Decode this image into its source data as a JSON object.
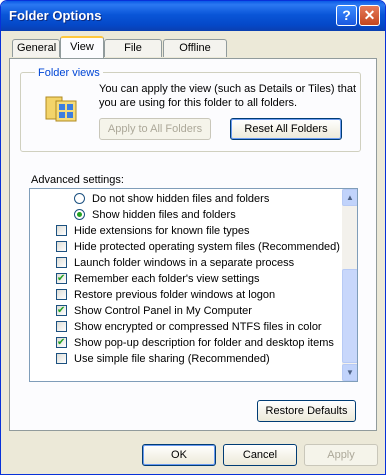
{
  "window": {
    "title": "Folder Options",
    "help_glyph": "?",
    "close_glyph": "✕"
  },
  "tabs": [
    {
      "label": "General"
    },
    {
      "label": "View"
    },
    {
      "label": "File Types"
    },
    {
      "label": "Offline Files"
    }
  ],
  "folder_views": {
    "title": "Folder views",
    "description": "You can apply the view (such as Details or Tiles) that you are using for this folder to all folders.",
    "apply_button": "Apply to All Folders",
    "reset_button": "Reset All Folders"
  },
  "advanced": {
    "label": "Advanced settings:",
    "items": [
      {
        "kind": "radio",
        "checked": false,
        "label": "Do not show hidden files and folders"
      },
      {
        "kind": "radio",
        "checked": true,
        "label": "Show hidden files and folders"
      },
      {
        "kind": "checkbox",
        "checked": false,
        "label": "Hide extensions for known file types"
      },
      {
        "kind": "checkbox",
        "checked": false,
        "label": "Hide protected operating system files (Recommended)"
      },
      {
        "kind": "checkbox",
        "checked": false,
        "label": "Launch folder windows in a separate process"
      },
      {
        "kind": "checkbox",
        "checked": true,
        "label": "Remember each folder's view settings"
      },
      {
        "kind": "checkbox",
        "checked": false,
        "label": "Restore previous folder windows at logon"
      },
      {
        "kind": "checkbox",
        "checked": true,
        "label": "Show Control Panel in My Computer"
      },
      {
        "kind": "checkbox",
        "checked": false,
        "label": "Show encrypted or compressed NTFS files in color"
      },
      {
        "kind": "checkbox",
        "checked": true,
        "label": "Show pop-up description for folder and desktop items"
      },
      {
        "kind": "checkbox",
        "checked": false,
        "label": "Use simple file sharing (Recommended)"
      }
    ],
    "scroll_up_glyph": "▲",
    "scroll_down_glyph": "▼"
  },
  "restore_defaults_button": "Restore Defaults",
  "footer": {
    "ok": "OK",
    "cancel": "Cancel",
    "apply": "Apply"
  }
}
